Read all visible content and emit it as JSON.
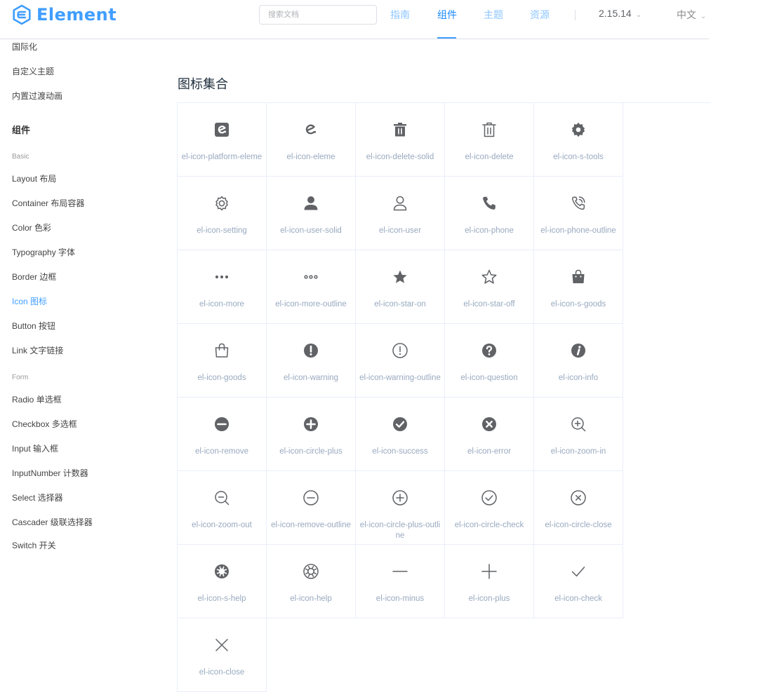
{
  "brand": {
    "name": "Element",
    "logo_icon": "element-logo-icon",
    "color": "#409eff"
  },
  "search": {
    "placeholder": "搜索文档"
  },
  "nav": {
    "items": [
      "指南",
      "组件",
      "主题",
      "资源"
    ],
    "active": "组件",
    "version": "2.15.14",
    "language": "中文"
  },
  "sidebar": {
    "top_items": [
      "国际化",
      "自定义主题",
      "内置过渡动画"
    ],
    "group": "组件",
    "basic_label": "Basic",
    "basic_items": [
      "Layout 布局",
      "Container 布局容器",
      "Color 色彩",
      "Typography 字体",
      "Border 边框",
      "Icon 图标",
      "Button 按钮",
      "Link 文字链接"
    ],
    "form_label": "Form",
    "form_items": [
      "Radio 单选框",
      "Checkbox 多选框",
      "Input 输入框",
      "InputNumber 计数器",
      "Select 选择器",
      "Cascader 级联选择器",
      "Switch 开关"
    ],
    "active_item": "Icon 图标"
  },
  "page": {
    "title": "图标集合"
  },
  "icons": [
    {
      "name": "el-icon-platform-eleme",
      "icon": "platform-eleme-icon"
    },
    {
      "name": "el-icon-eleme",
      "icon": "eleme-icon"
    },
    {
      "name": "el-icon-delete-solid",
      "icon": "delete-solid-icon"
    },
    {
      "name": "el-icon-delete",
      "icon": "delete-icon"
    },
    {
      "name": "el-icon-s-tools",
      "icon": "s-tools-icon"
    },
    {
      "name": "el-icon-setting",
      "icon": "setting-icon"
    },
    {
      "name": "el-icon-user-solid",
      "icon": "user-solid-icon"
    },
    {
      "name": "el-icon-user",
      "icon": "user-icon"
    },
    {
      "name": "el-icon-phone",
      "icon": "phone-icon"
    },
    {
      "name": "el-icon-phone-outline",
      "icon": "phone-outline-icon"
    },
    {
      "name": "el-icon-more",
      "icon": "more-icon"
    },
    {
      "name": "el-icon-more-outline",
      "icon": "more-outline-icon"
    },
    {
      "name": "el-icon-star-on",
      "icon": "star-on-icon"
    },
    {
      "name": "el-icon-star-off",
      "icon": "star-off-icon"
    },
    {
      "name": "el-icon-s-goods",
      "icon": "s-goods-icon"
    },
    {
      "name": "el-icon-goods",
      "icon": "goods-icon"
    },
    {
      "name": "el-icon-warning",
      "icon": "warning-icon"
    },
    {
      "name": "el-icon-warning-outline",
      "icon": "warning-outline-icon"
    },
    {
      "name": "el-icon-question",
      "icon": "question-icon"
    },
    {
      "name": "el-icon-info",
      "icon": "info-icon"
    },
    {
      "name": "el-icon-remove",
      "icon": "remove-icon"
    },
    {
      "name": "el-icon-circle-plus",
      "icon": "circle-plus-icon"
    },
    {
      "name": "el-icon-success",
      "icon": "success-icon"
    },
    {
      "name": "el-icon-error",
      "icon": "error-icon"
    },
    {
      "name": "el-icon-zoom-in",
      "icon": "zoom-in-icon"
    },
    {
      "name": "el-icon-zoom-out",
      "icon": "zoom-out-icon"
    },
    {
      "name": "el-icon-remove-outline",
      "icon": "remove-outline-icon"
    },
    {
      "name": "el-icon-circle-plus-outline",
      "icon": "circle-plus-outline-icon"
    },
    {
      "name": "el-icon-circle-check",
      "icon": "circle-check-icon"
    },
    {
      "name": "el-icon-circle-close",
      "icon": "circle-close-icon"
    },
    {
      "name": "el-icon-s-help",
      "icon": "s-help-icon"
    },
    {
      "name": "el-icon-help",
      "icon": "help-icon"
    },
    {
      "name": "el-icon-minus",
      "icon": "minus-icon"
    },
    {
      "name": "el-icon-plus",
      "icon": "plus-icon"
    },
    {
      "name": "el-icon-check",
      "icon": "check-icon"
    },
    {
      "name": "el-icon-close",
      "icon": "close-icon"
    }
  ],
  "colors": {
    "accent": "#409eff",
    "icon": "#606266",
    "icon_name": "#99a9bf",
    "border": "#eaeefb"
  }
}
